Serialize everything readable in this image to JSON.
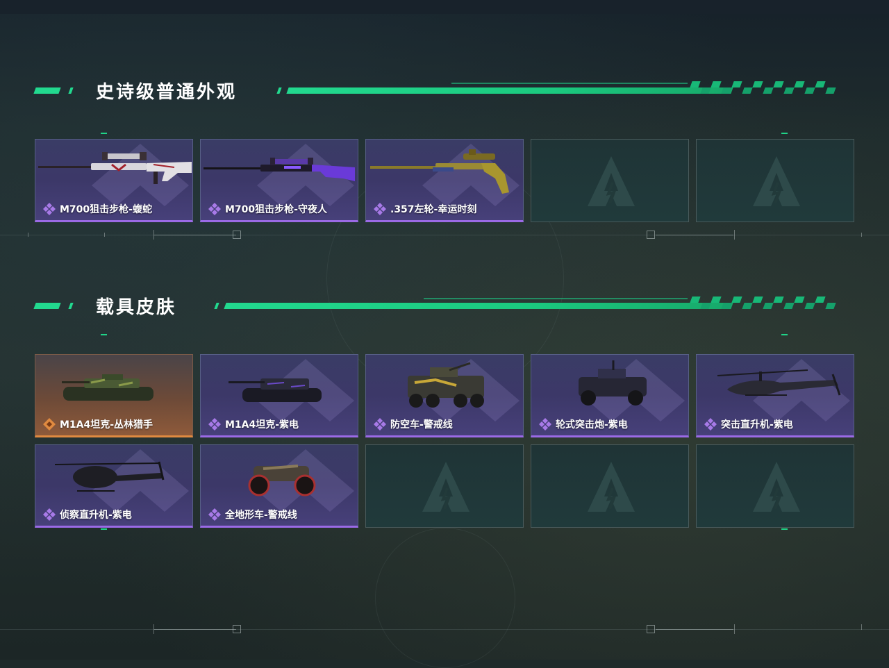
{
  "sections": [
    {
      "title": "史诗级普通外观",
      "items": [
        {
          "name": "M700狙击步枪-蝮蛇",
          "rarity": "purple",
          "icon": "sniper-rifle-icon"
        },
        {
          "name": "M700狙击步枪-守夜人",
          "rarity": "purple",
          "icon": "sniper-rifle-icon"
        },
        {
          "name": ".357左轮-幸运时刻",
          "rarity": "purple",
          "icon": "revolver-rifle-icon"
        },
        {
          "name": "",
          "rarity": "empty"
        },
        {
          "name": "",
          "rarity": "empty"
        }
      ]
    },
    {
      "title": "载具皮肤",
      "items": [
        {
          "name": "M1A4坦克-丛林猎手",
          "rarity": "orange",
          "icon": "tank-icon"
        },
        {
          "name": "M1A4坦克-紫电",
          "rarity": "purple",
          "icon": "tank-icon"
        },
        {
          "name": "防空车-警戒线",
          "rarity": "purple",
          "icon": "anti-air-vehicle-icon"
        },
        {
          "name": "轮式突击炮-紫电",
          "rarity": "purple",
          "icon": "wheeled-assault-gun-icon"
        },
        {
          "name": "突击直升机-紫电",
          "rarity": "purple",
          "icon": "attack-helicopter-icon"
        },
        {
          "name": "侦察直升机-紫电",
          "rarity": "purple",
          "icon": "scout-helicopter-icon"
        },
        {
          "name": "全地形车-警戒线",
          "rarity": "purple",
          "icon": "atv-icon"
        },
        {
          "name": "",
          "rarity": "empty"
        },
        {
          "name": "",
          "rarity": "empty"
        },
        {
          "name": "",
          "rarity": "empty"
        }
      ]
    }
  ],
  "colors": {
    "accent_green": "#22d98f",
    "rarity_purple": "#9b6ae6",
    "rarity_orange": "#e08a40"
  }
}
